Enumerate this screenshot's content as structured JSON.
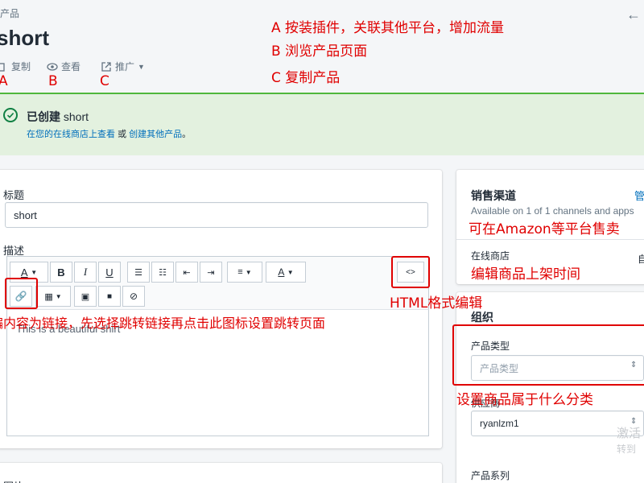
{
  "header": {
    "breadcrumb": "产品",
    "title": "short",
    "actions": {
      "copy": "复制",
      "view": "查看",
      "promote": "推广"
    }
  },
  "banner": {
    "title_prefix": "已创建",
    "title_name": "short",
    "link_view": "在您的在线商店上查看",
    "or": "或",
    "link_create": "创建其他产品",
    "end": "。"
  },
  "form": {
    "title_label": "标题",
    "title_value": "short",
    "desc_label": "描述",
    "desc_text": "This is a beautiful shirt"
  },
  "sidebar": {
    "channels_title": "销售渠道",
    "channels_manage": "管",
    "channels_sub": "Available on 1 of 1 channels and apps",
    "online_store": "在线商店",
    "online_store_tail": "自",
    "org_title": "组织",
    "type_label": "产品类型",
    "type_placeholder": "产品类型",
    "vendor_label": "供应商",
    "vendor_value": "ryanlzm1",
    "collection_label": "产品系列"
  },
  "annotations": {
    "letter_a": "A",
    "letter_b": "B",
    "letter_c": "C",
    "note_a": "A  按装插件，关联其他平台，增加流量",
    "note_b": "B  浏览产品页面",
    "note_c": "C  复制产品",
    "link_note": "编内容为链接，先选择跳转链接再点击此图标设置跳转页面",
    "html_note": "HTML格式编辑",
    "amazon_note": "可在Amazon等平台售卖",
    "schedule_note": "编辑商品上架时间",
    "category_note": "设置商品属于什么分类"
  },
  "watermark": {
    "line1": "激活",
    "line2": "转到"
  },
  "bottom": {
    "card_label": "图片"
  },
  "colors": {
    "success_green": "#50b83c",
    "banner_bg": "#e3f1df",
    "link_blue": "#006fbb",
    "annotation_red": "#e00000"
  }
}
